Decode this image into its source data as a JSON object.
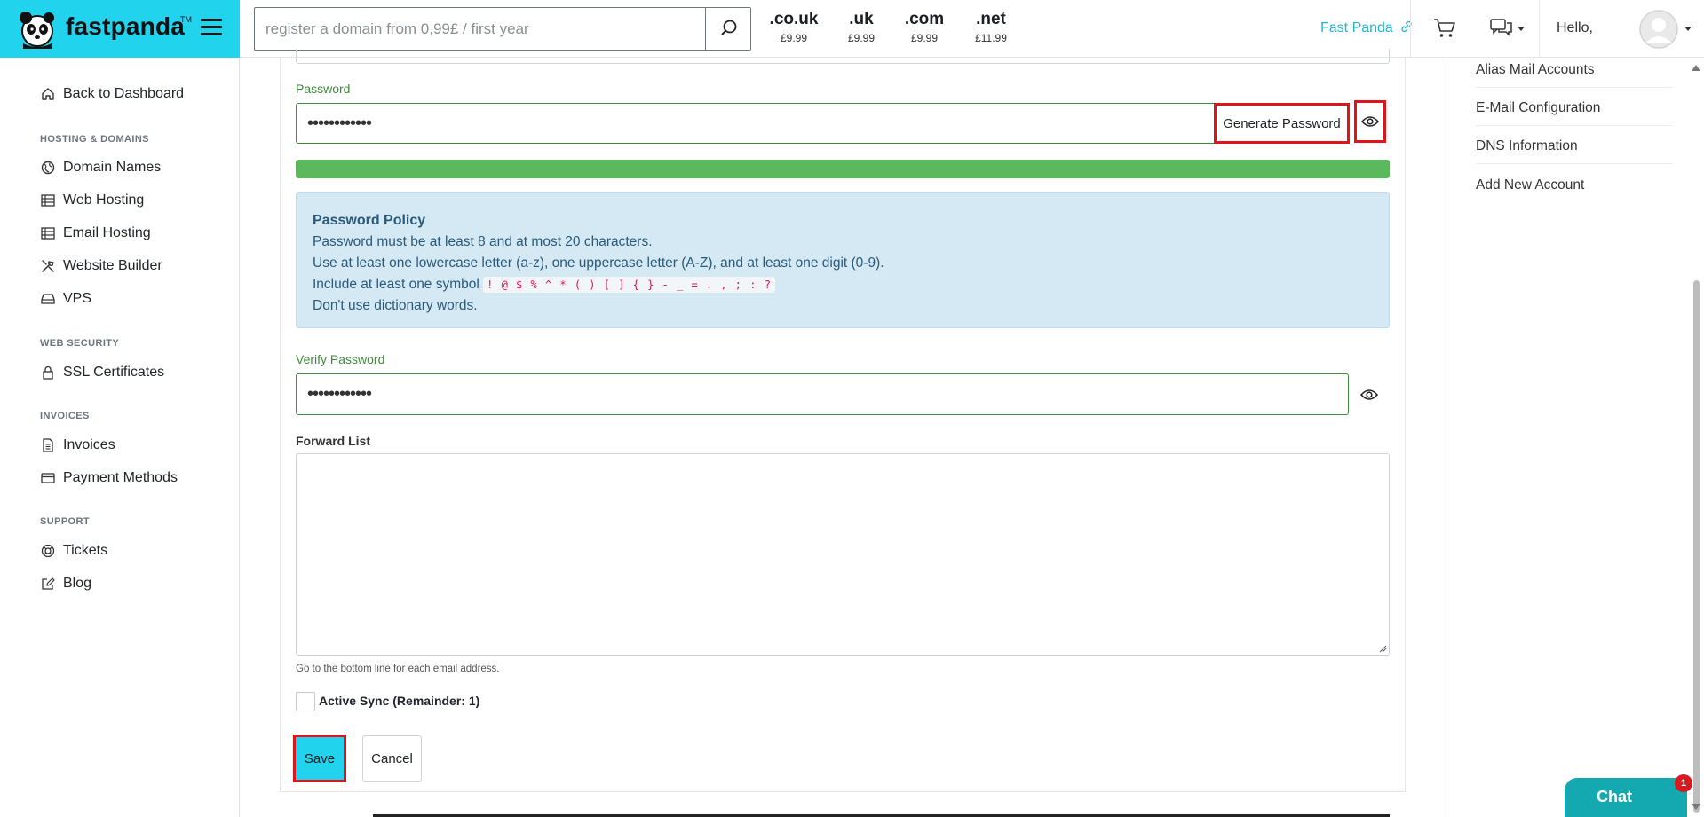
{
  "header": {
    "brand": "fastpanda",
    "trademark": "TM",
    "search_placeholder": "register a domain from 0,99£ / first year",
    "tlds": [
      {
        "name": ".co.uk",
        "price": "£9.99"
      },
      {
        "name": ".uk",
        "price": "£9.99"
      },
      {
        "name": ".com",
        "price": "£9.99"
      },
      {
        "name": ".net",
        "price": "£11.99"
      }
    ],
    "brand_link": "Fast Panda",
    "greeting": "Hello,"
  },
  "sidebar": {
    "back": "Back to Dashboard",
    "sections": {
      "hosting": "HOSTING & DOMAINS",
      "security": "WEB SECURITY",
      "invoices": "INVOICES",
      "support": "SUPPORT"
    },
    "items": {
      "domain_names": "Domain Names",
      "web_hosting": "Web Hosting",
      "email_hosting": "Email Hosting",
      "website_builder": "Website Builder",
      "vps": "VPS",
      "ssl": "SSL Certificates",
      "invoices": "Invoices",
      "payment_methods": "Payment Methods",
      "tickets": "Tickets",
      "blog": "Blog"
    }
  },
  "form": {
    "password_label": "Password",
    "password_value": "••••••••••••",
    "generate_label": "Generate Password",
    "strength_percent": 100,
    "policy": {
      "title": "Password Policy",
      "line1": "Password must be at least 8 and at most 20 characters.",
      "line2": "Use at least one lowercase letter (a-z), one uppercase letter (A-Z), and at least one digit (0-9).",
      "line3_prefix": "Include at least one symbol",
      "symbols": "! @ $ % ^ * ( ) [ ] { } - _ = . , ; : ?",
      "line4": "Don't use dictionary words."
    },
    "verify_label": "Verify Password",
    "verify_value": "••••••••••••",
    "forward_label": "Forward List",
    "forward_hint": "Go to the bottom line for each email address.",
    "sync_label": "Active Sync (Remainder: 1)",
    "save_label": "Save",
    "cancel_label": "Cancel"
  },
  "right_panel": {
    "items": [
      "Alias Mail Accounts",
      "E-Mail Configuration",
      "DNS Information",
      "Add New Account"
    ]
  },
  "chat": {
    "label": "Chat",
    "badge": "1"
  },
  "colors": {
    "brand": "#22d3ee",
    "success": "#5cb85c",
    "highlight": "#e0141c",
    "chat": "#14a8b0"
  }
}
